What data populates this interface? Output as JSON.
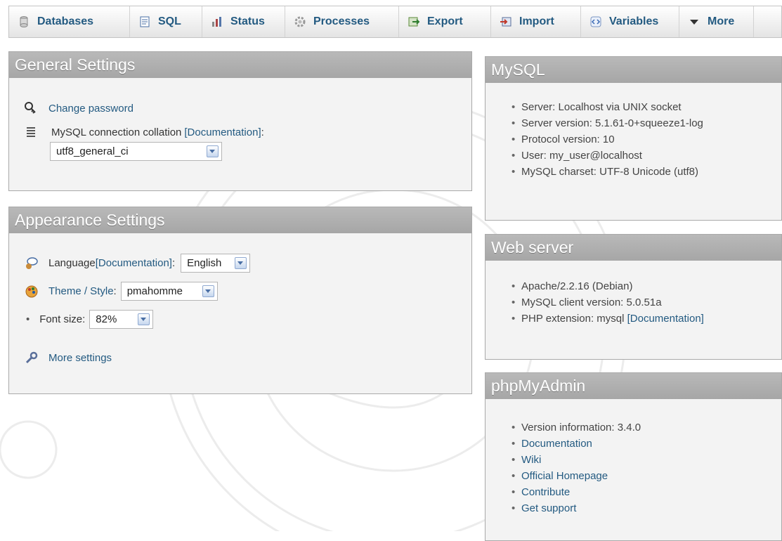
{
  "tabs": [
    {
      "label": "Databases",
      "icon": "database-icon"
    },
    {
      "label": "SQL",
      "icon": "sql-icon"
    },
    {
      "label": "Status",
      "icon": "status-chart-icon"
    },
    {
      "label": "Processes",
      "icon": "processes-gear-icon"
    },
    {
      "label": "Export",
      "icon": "export-icon"
    },
    {
      "label": "Import",
      "icon": "import-icon"
    },
    {
      "label": "Variables",
      "icon": "variables-icon"
    },
    {
      "label": "More",
      "icon": "more-arrow-icon"
    }
  ],
  "general": {
    "title": "General Settings",
    "change_password": "Change password",
    "collation_label": "MySQL connection collation",
    "collation_doc": "[Documentation]",
    "collation_colon": ":",
    "collation_value": "utf8_general_ci"
  },
  "appearance": {
    "title": "Appearance Settings",
    "language_label": "Language",
    "language_doc": "[Documentation]",
    "language_colon": ":",
    "language_value": "English",
    "theme_label": "Theme / Style",
    "theme_colon": ":",
    "theme_value": "pmahomme",
    "font_label": "Font size:",
    "font_value": "82%",
    "more_settings": "More settings"
  },
  "mysql": {
    "title": "MySQL",
    "items": [
      "Server: Localhost via UNIX socket",
      "Server version: 5.1.61-0+squeeze1-log",
      "Protocol version: 10",
      "User: my_user@localhost",
      "MySQL charset: UTF-8 Unicode (utf8)"
    ]
  },
  "webserver": {
    "title": "Web server",
    "items": [
      "Apache/2.2.16 (Debian)",
      "MySQL client version: 5.0.51a",
      "PHP extension: mysql "
    ],
    "doc_link": "[Documentation]"
  },
  "phpmyadmin": {
    "title": "phpMyAdmin",
    "version": "Version information: 3.4.0",
    "links": [
      "Documentation",
      "Wiki",
      "Official Homepage",
      "Contribute",
      "Get support"
    ]
  },
  "colors": {
    "link": "#235a81",
    "panel_header": "#aeaeae",
    "panel_bg": "#f3f3f3"
  }
}
